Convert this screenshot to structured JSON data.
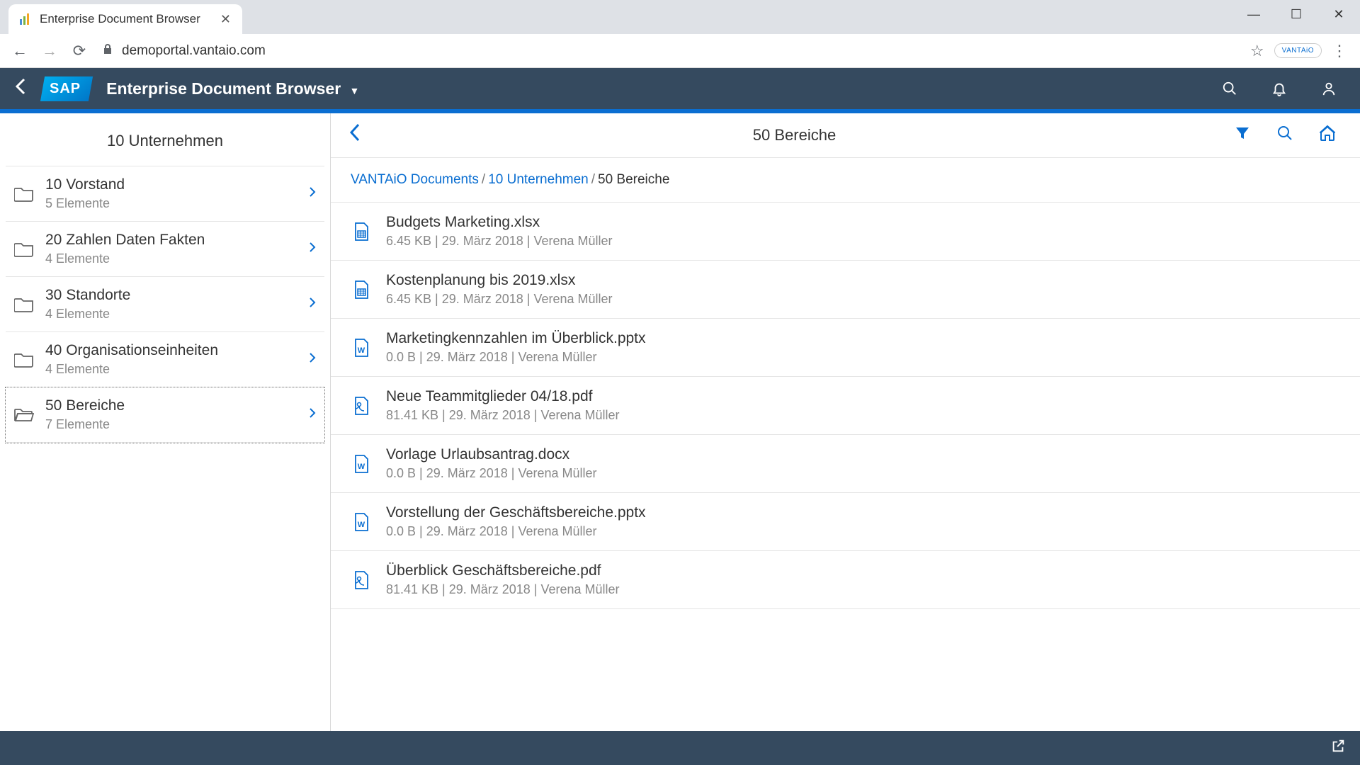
{
  "browser": {
    "tab_title": "Enterprise Document Browser",
    "url": "demoportal.vantaio.com",
    "vantaio_label": "VANTAiO"
  },
  "shell": {
    "title": "Enterprise Document Browser"
  },
  "sidebar": {
    "title": "10 Unternehmen",
    "folders": [
      {
        "name": "10 Vorstand",
        "count": "5 Elemente",
        "selected": false
      },
      {
        "name": "20 Zahlen Daten Fakten",
        "count": "4 Elemente",
        "selected": false
      },
      {
        "name": "30 Standorte",
        "count": "4 Elemente",
        "selected": false
      },
      {
        "name": "40 Organisationseinheiten",
        "count": "4 Elemente",
        "selected": false
      },
      {
        "name": "50 Bereiche",
        "count": "7 Elemente",
        "selected": true
      }
    ]
  },
  "main": {
    "title": "50 Bereiche",
    "breadcrumb": {
      "parts": [
        {
          "label": "VANTAiO Documents",
          "link": true
        },
        {
          "label": "10 Unternehmen",
          "link": true
        },
        {
          "label": "50 Bereiche",
          "link": false
        }
      ]
    },
    "files": [
      {
        "name": "Budgets Marketing.xlsx",
        "meta": "6.45 KB | 29. März 2018 | Verena Müller",
        "type": "xlsx"
      },
      {
        "name": "Kostenplanung bis 2019.xlsx",
        "meta": "6.45 KB | 29. März 2018 | Verena Müller",
        "type": "xlsx"
      },
      {
        "name": "Marketingkennzahlen im Überblick.pptx",
        "meta": "0.0 B | 29. März 2018 | Verena Müller",
        "type": "pptx"
      },
      {
        "name": "Neue Teammitglieder 04/18.pdf",
        "meta": "81.41 KB | 29. März 2018 | Verena Müller",
        "type": "pdf"
      },
      {
        "name": "Vorlage Urlaubsantrag.docx",
        "meta": "0.0 B | 29. März 2018 | Verena Müller",
        "type": "docx"
      },
      {
        "name": "Vorstellung der Geschäftsbereiche.pptx",
        "meta": "0.0 B | 29. März 2018 | Verena Müller",
        "type": "pptx"
      },
      {
        "name": "Überblick Geschäftsbereiche.pdf",
        "meta": "81.41 KB | 29. März 2018 | Verena Müller",
        "type": "pdf"
      }
    ]
  }
}
